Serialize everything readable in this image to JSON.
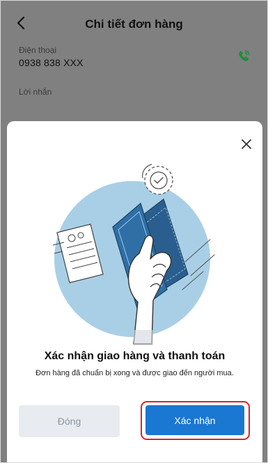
{
  "header": {
    "title": "Chi tiết đơn hàng"
  },
  "order": {
    "phone_label": "Điện thoại",
    "phone_value": "0938 838 XXX",
    "message_label": "Lời nhắn"
  },
  "dialog": {
    "title": "Xác nhận giao hàng và thanh toán",
    "subtitle": "Đơn hàng đã chuẩn bị xong và được giao đến người mua.",
    "close_button_label": "Đóng",
    "confirm_button_label": "Xác nhận"
  },
  "icons": {
    "back": "chevron-left-icon",
    "call": "phone-icon",
    "close": "close-icon",
    "illustration": "hand-holding-cash-illustration"
  },
  "colors": {
    "primary": "#1a77d2",
    "highlight_outline": "#d6242f",
    "call_icon": "#1e8f3a",
    "illustration_circle": "#a9cfe6",
    "disabled_button_bg": "#e8ecf1"
  }
}
